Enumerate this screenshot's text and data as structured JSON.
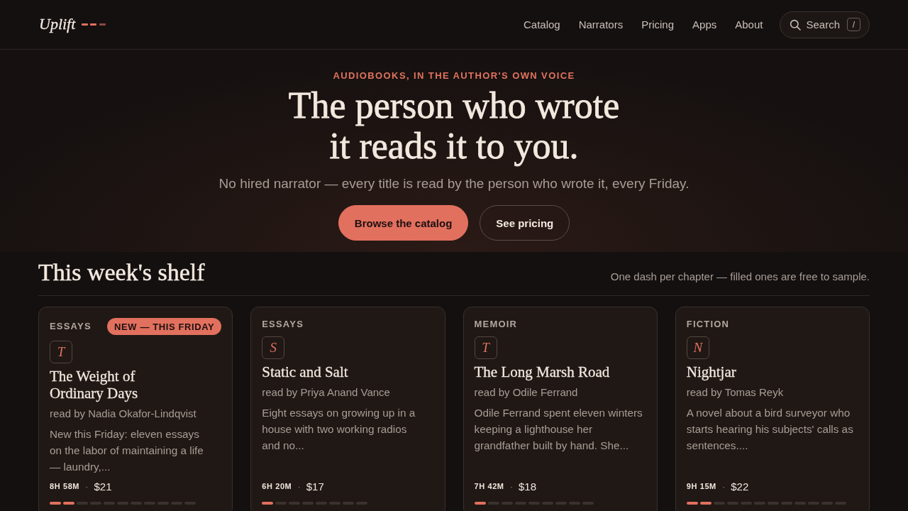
{
  "header": {
    "logo": "Uplift",
    "nav": [
      "Catalog",
      "Narrators",
      "Pricing",
      "Apps",
      "About"
    ],
    "search": {
      "label": "Search",
      "shortcut": "/"
    }
  },
  "hero": {
    "eyebrow": "AUDIOBOOKS, IN THE AUTHOR'S OWN VOICE",
    "headline": "The person who wrote it reads it to you.",
    "subtitle": "No hired narrator — every title is read by the person who wrote it, every Friday.",
    "buttons": [
      {
        "label": "Browse the catalog",
        "kind": "primary"
      },
      {
        "label": "See pricing",
        "kind": "secondary"
      }
    ]
  },
  "shelf": {
    "title": "This week's shelf",
    "note": "One dash per chapter — filled ones are free to sample.",
    "cards": [
      {
        "category": "ESSAYS",
        "badge": "NEW — THIS FRIDAY",
        "initial": "T",
        "title": "The Weight of Ordinary Days",
        "reader": "read by Nadia Okafor-Lindqvist",
        "description": "New this Friday: eleven essays on the labor of maintaining a life — laundry,...",
        "duration": "8H 58M",
        "separator": "·",
        "price": "$21",
        "chapters": [
          {
            "free": true
          },
          {
            "free": true
          },
          {
            "free": false
          },
          {
            "free": false
          },
          {
            "free": false
          },
          {
            "free": false
          },
          {
            "free": false
          },
          {
            "free": false
          },
          {
            "free": false
          },
          {
            "free": false
          },
          {
            "free": false
          }
        ]
      },
      {
        "category": "ESSAYS",
        "initial": "S",
        "title": "Static and Salt",
        "reader": "read by Priya Anand Vance",
        "description": "Eight essays on growing up in a house with two working radios and no...",
        "duration": "6H 20M",
        "separator": "·",
        "price": "$17",
        "chapters": [
          {
            "free": true
          },
          {
            "free": false
          },
          {
            "free": false
          },
          {
            "free": false
          },
          {
            "free": false
          },
          {
            "free": false
          },
          {
            "free": false
          },
          {
            "free": false
          }
        ]
      },
      {
        "category": "MEMOIR",
        "initial": "T",
        "title": "The Long Marsh Road",
        "reader": "read by Odile Ferrand",
        "description": "Odile Ferrand spent eleven winters keeping a lighthouse her grandfather built by hand. She...",
        "duration": "7H 42M",
        "separator": "·",
        "price": "$18",
        "chapters": [
          {
            "free": true
          },
          {
            "free": false
          },
          {
            "free": false
          },
          {
            "free": false
          },
          {
            "free": false
          },
          {
            "free": false
          },
          {
            "free": false
          },
          {
            "free": false
          },
          {
            "free": false
          }
        ]
      },
      {
        "category": "FICTION",
        "initial": "N",
        "title": "Nightjar",
        "reader": "read by Tomas Reyk",
        "description": "A novel about a bird surveyor who starts hearing his subjects' calls as sentences....",
        "duration": "9H 15M",
        "separator": "·",
        "price": "$22",
        "chapters": [
          {
            "free": true
          },
          {
            "free": true
          },
          {
            "free": false
          },
          {
            "free": false
          },
          {
            "free": false
          },
          {
            "free": false
          },
          {
            "free": false
          },
          {
            "free": false
          },
          {
            "free": false
          },
          {
            "free": false
          },
          {
            "free": false
          },
          {
            "free": false
          }
        ]
      }
    ]
  }
}
